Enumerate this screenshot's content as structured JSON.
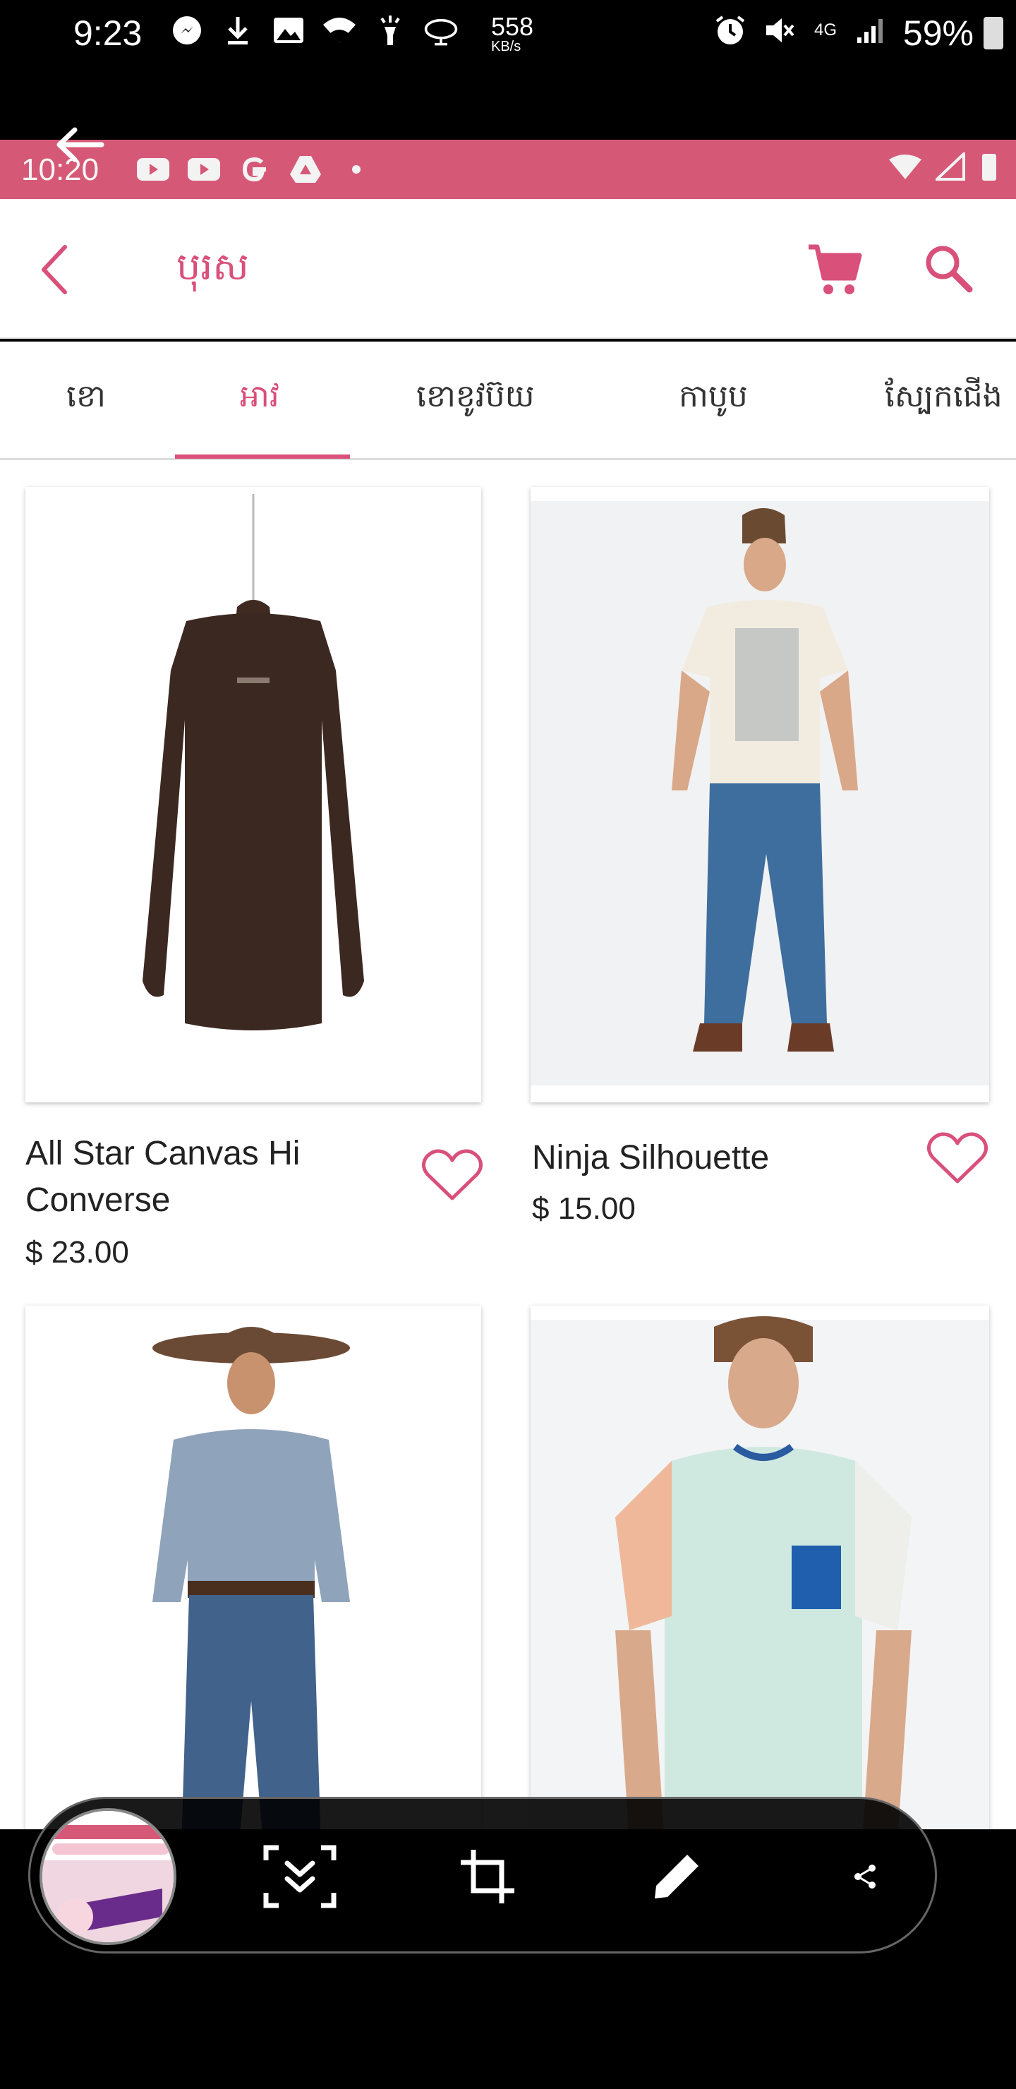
{
  "system_status": {
    "time": "9:23",
    "net_speed": "558",
    "net_speed_unit": "KB/s",
    "network": "4G",
    "battery": "59%"
  },
  "inner_status": {
    "time": "10:20"
  },
  "app_bar": {
    "title": "បុរស"
  },
  "tabs": [
    {
      "label": "ខោ",
      "active": false
    },
    {
      "label": "អាវ",
      "active": true
    },
    {
      "label": "ខោខូវប៊យ",
      "active": false
    },
    {
      "label": "កាបូប",
      "active": false
    },
    {
      "label": "ស្បែកជើង",
      "active": false
    }
  ],
  "products": [
    {
      "name": "All Star Canvas Hi Converse",
      "price": "$ 23.00"
    },
    {
      "name": "Ninja Silhouette",
      "price": "$ 15.00"
    }
  ],
  "colors": {
    "accent": "#d9507a",
    "inner_status_bar": "#d65877"
  },
  "icons": {
    "cart": "cart-icon",
    "search": "search-icon",
    "favorite": "heart-icon",
    "back": "back-arrow-icon"
  }
}
